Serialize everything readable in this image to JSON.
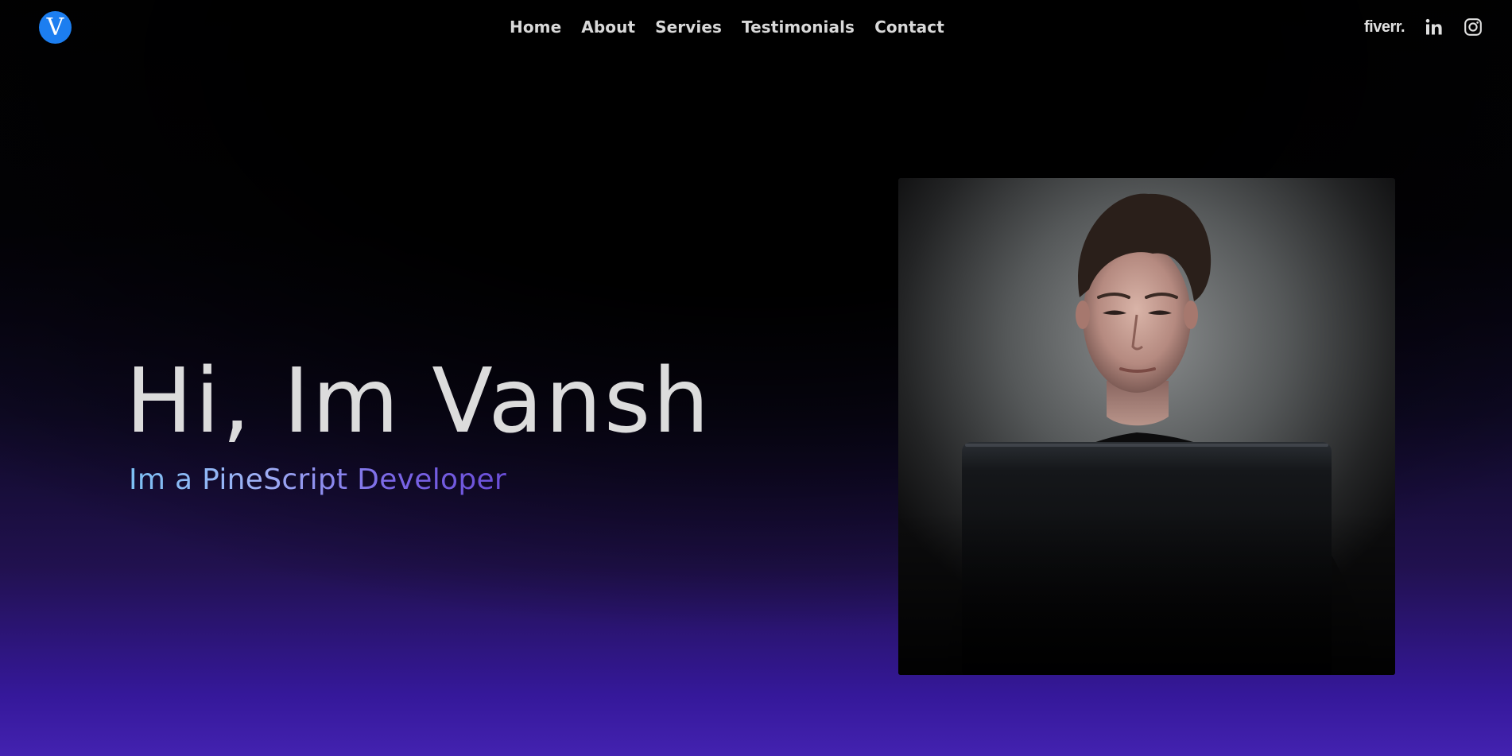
{
  "nav": {
    "logo_letter": "V",
    "links": [
      {
        "label": "Home"
      },
      {
        "label": "About"
      },
      {
        "label": "Servies"
      },
      {
        "label": "Testimonials"
      },
      {
        "label": "Contact"
      }
    ],
    "social": {
      "fiverr_label": "fiverr.",
      "icons": [
        "linkedin-icon",
        "instagram-icon"
      ]
    }
  },
  "hero": {
    "title": "Hi, Im Vansh",
    "subtitle": "Im a PineScript Developer",
    "photo_alt": "Portrait of a young man lit by a laptop screen"
  },
  "colors": {
    "logo_bg": "#1c7ef0",
    "text_light": "#dcdcdc",
    "subtitle_start": "#7cc0f4",
    "subtitle_end": "#6a4ed8",
    "gradient_bottom": "#4322b0"
  }
}
